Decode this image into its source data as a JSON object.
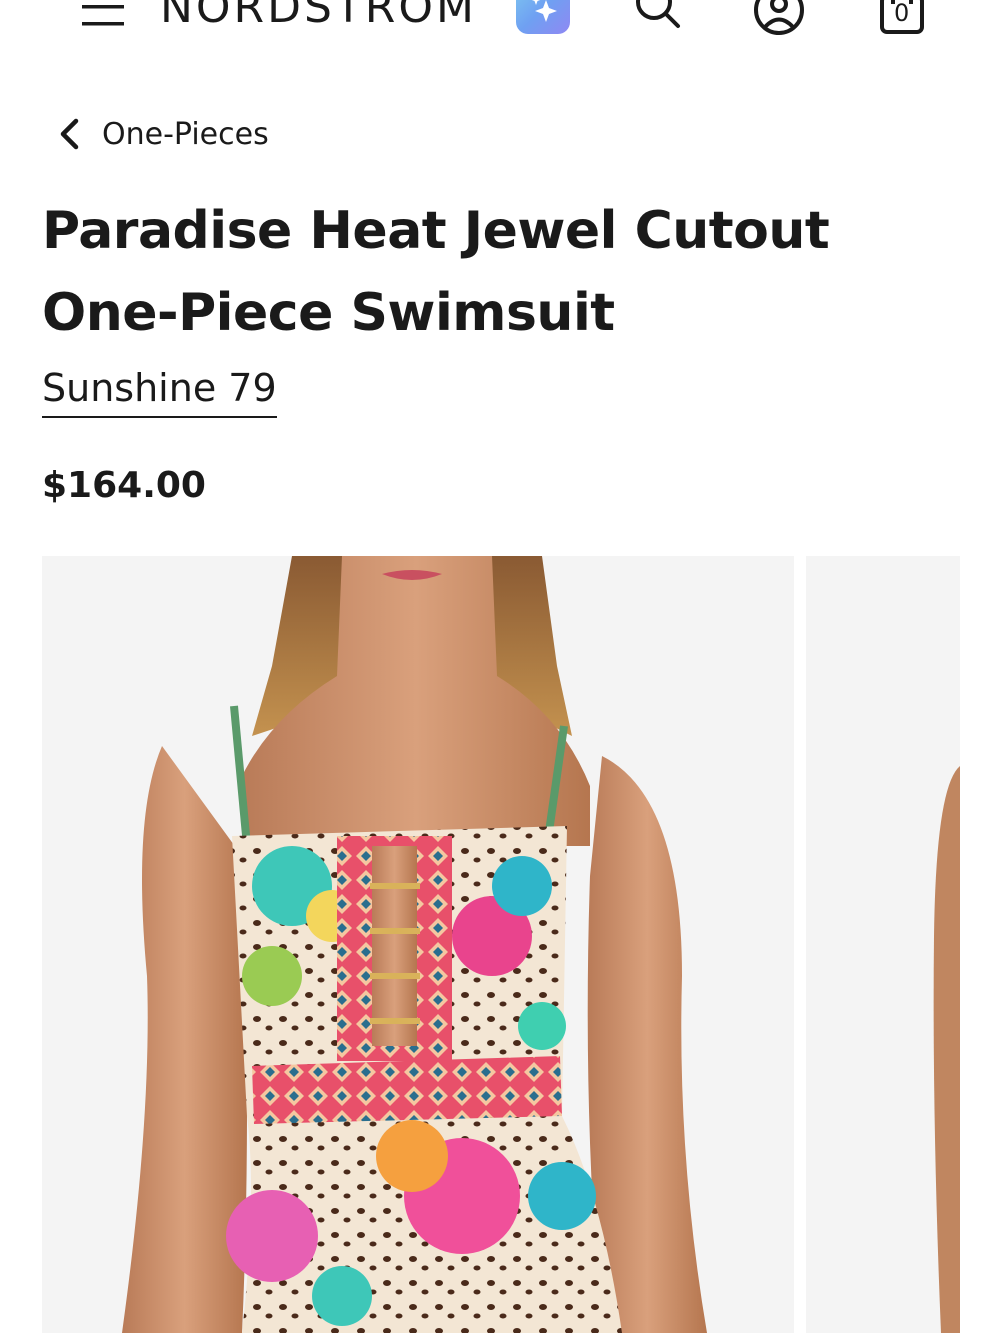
{
  "header": {
    "logo_text": "NORDSTROM",
    "cart_count": "0",
    "icons": [
      "menu-icon",
      "ai-sparkle-icon",
      "search-icon",
      "account-icon",
      "shopping-bag-icon"
    ]
  },
  "breadcrumb": {
    "label": "One-Pieces"
  },
  "product": {
    "title": "Paradise Heat Jewel Cutout One-Piece Swimsuit",
    "brand": "Sunshine 79",
    "price": "$164.00"
  },
  "colors": {
    "text": "#1a1a1a",
    "image_background": "#f4f4f4",
    "ai_gradient_start": "#7ec8f0",
    "ai_gradient_end": "#8f88f3"
  }
}
